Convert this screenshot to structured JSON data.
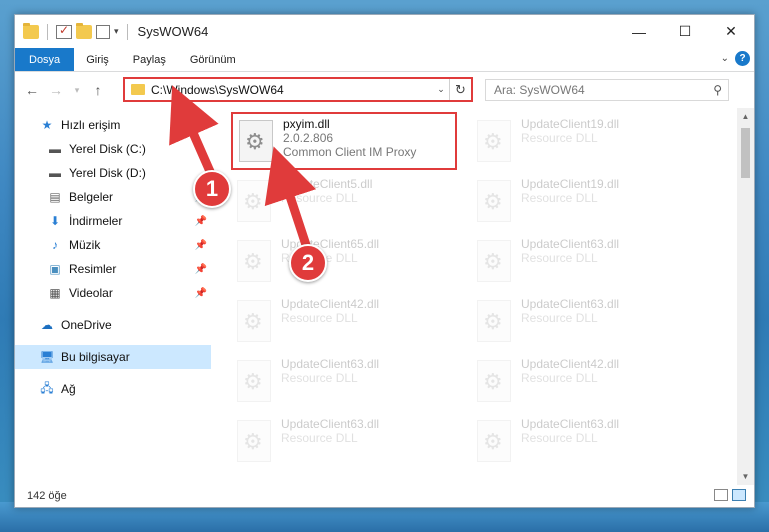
{
  "window": {
    "title": "SysWOW64",
    "controls": {
      "minimize": "—",
      "maximize": "☐",
      "close": "✕"
    }
  },
  "ribbon": {
    "tabs": [
      "Dosya",
      "Giriş",
      "Paylaş",
      "Görünüm"
    ],
    "help": "?"
  },
  "address": {
    "path": "C:\\Windows\\SysWOW64",
    "search_placeholder": "Ara: SysWOW64"
  },
  "sidebar": {
    "items": [
      {
        "label": "Hızlı erişim",
        "icon": "star-icon",
        "pinned": false
      },
      {
        "label": "Yerel Disk (C:)",
        "icon": "drive-icon",
        "pinned": false
      },
      {
        "label": "Yerel Disk (D:)",
        "icon": "drive-icon",
        "pinned": false
      },
      {
        "label": "Belgeler",
        "icon": "documents-icon",
        "pinned": true
      },
      {
        "label": "İndirmeler",
        "icon": "download-icon",
        "pinned": true
      },
      {
        "label": "Müzik",
        "icon": "music-icon",
        "pinned": true
      },
      {
        "label": "Resimler",
        "icon": "pictures-icon",
        "pinned": true
      },
      {
        "label": "Videolar",
        "icon": "video-icon",
        "pinned": true
      },
      {
        "label": "OneDrive",
        "icon": "cloud-icon",
        "pinned": false
      },
      {
        "label": "Bu bilgisayar",
        "icon": "computer-icon",
        "pinned": false,
        "selected": true
      },
      {
        "label": "Ağ",
        "icon": "network-icon",
        "pinned": false
      }
    ]
  },
  "files": {
    "highlighted": {
      "name": "pxyim.dll",
      "version": "2.0.2.806",
      "description": "Common Client IM Proxy"
    },
    "others": [
      {
        "name": "UpdateClient19.dll",
        "type": "Resource DLL"
      },
      {
        "name": "UpdateClient5.dll",
        "type": "Resource DLL"
      },
      {
        "name": "UpdateClient19.dll",
        "type": "Resource DLL"
      },
      {
        "name": "UpdateClient65.dll",
        "type": "Resource DLL"
      },
      {
        "name": "UpdateClient63.dll",
        "type": "Resource DLL"
      },
      {
        "name": "UpdateClient42.dll",
        "type": "Resource DLL"
      },
      {
        "name": "UpdateClient63.dll",
        "type": "Resource DLL"
      },
      {
        "name": "UpdateClient63.dll",
        "type": "Resource DLL"
      },
      {
        "name": "UpdateClient42.dll",
        "type": "Resource DLL"
      },
      {
        "name": "UpdateClient63.dll",
        "type": "Resource DLL"
      },
      {
        "name": "UpdateClient63.dll",
        "type": "Resource DLL"
      }
    ]
  },
  "status": {
    "count": "142 öğe"
  },
  "annotations": {
    "step1": "1",
    "step2": "2",
    "color": "#e03b3b"
  }
}
